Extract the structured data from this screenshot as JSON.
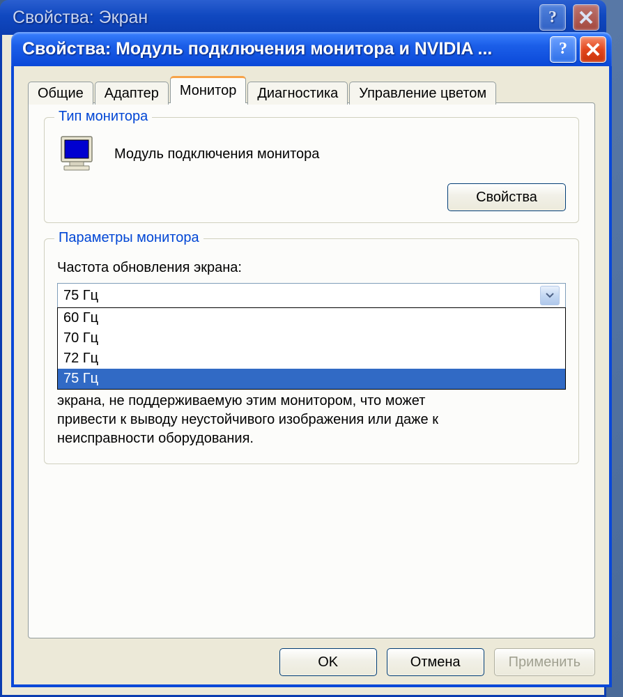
{
  "parent_window": {
    "title": "Свойства: Экран"
  },
  "dialog": {
    "title": "Свойства: Модуль подключения монитора и NVIDIA ..."
  },
  "tabs": {
    "general": "Общие",
    "adapter": "Адаптер",
    "monitor": "Монитор",
    "diagnostics": "Диагностика",
    "color_mgmt": "Управление цветом"
  },
  "group_monitor_type": {
    "title": "Тип монитора",
    "device_name": "Модуль подключения монитора",
    "properties_btn": "Свойства"
  },
  "group_monitor_params": {
    "title": "Параметры монитора",
    "refresh_label": "Частота обновления экрана:",
    "selected": "75 Гц",
    "options": [
      "60 Гц",
      "70 Гц",
      "72 Гц",
      "75 Гц"
    ],
    "partial_text_visible": "экрана, не поддерживаемую этим монитором, что может",
    "info_text_line2": "привести к выводу неустойчивого изображения или даже к",
    "info_text_line3": "неисправности оборудования."
  },
  "buttons": {
    "ok": "OK",
    "cancel": "Отмена",
    "apply": "Применить"
  }
}
